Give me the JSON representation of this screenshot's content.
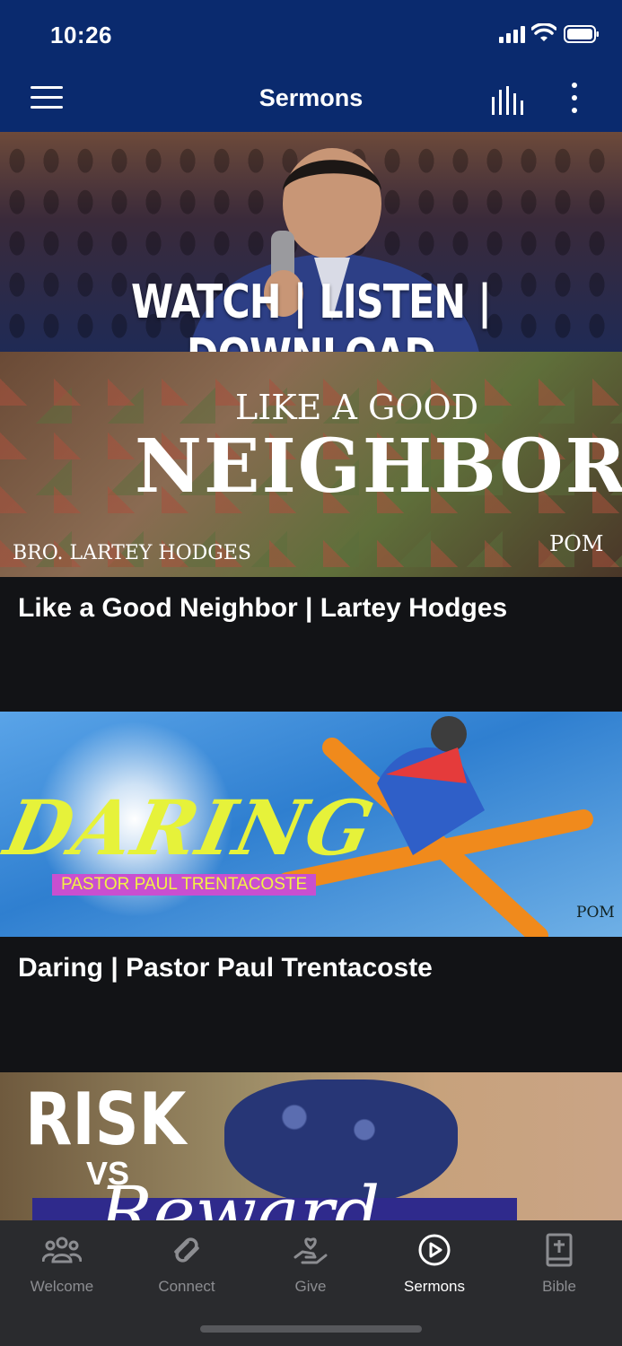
{
  "status_bar": {
    "time": "10:26"
  },
  "header": {
    "title": "Sermons"
  },
  "hero": {
    "caption": "WATCH | LISTEN | DOWNLOAD"
  },
  "sermons": [
    {
      "title": "Like a Good Neighbor | Lartey Hodges",
      "art_line1": "LIKE A GOOD",
      "art_line2": "NEIGHBOR",
      "art_byline": "BRO. LARTEY HODGES",
      "art_logo": "POM"
    },
    {
      "title": "Daring | Pastor Paul Trentacoste",
      "art_line1": "DARING",
      "art_byline": "PASTOR PAUL TRENTACOSTE",
      "art_logo": "POM"
    },
    {
      "art_line1": "RISK",
      "art_line2": "VS",
      "art_line3": "Reward"
    }
  ],
  "tabs": [
    {
      "label": "Welcome",
      "icon": "people-icon",
      "active": false
    },
    {
      "label": "Connect",
      "icon": "connect-icon",
      "active": false
    },
    {
      "label": "Give",
      "icon": "give-hand-heart-icon",
      "active": false
    },
    {
      "label": "Sermons",
      "icon": "play-circle-icon",
      "active": true
    },
    {
      "label": "Bible",
      "icon": "bible-icon",
      "active": false
    }
  ],
  "colors": {
    "header_bg": "#0a2a6e",
    "tabbar_bg": "#2a2b2e",
    "content_bg": "#121316"
  }
}
